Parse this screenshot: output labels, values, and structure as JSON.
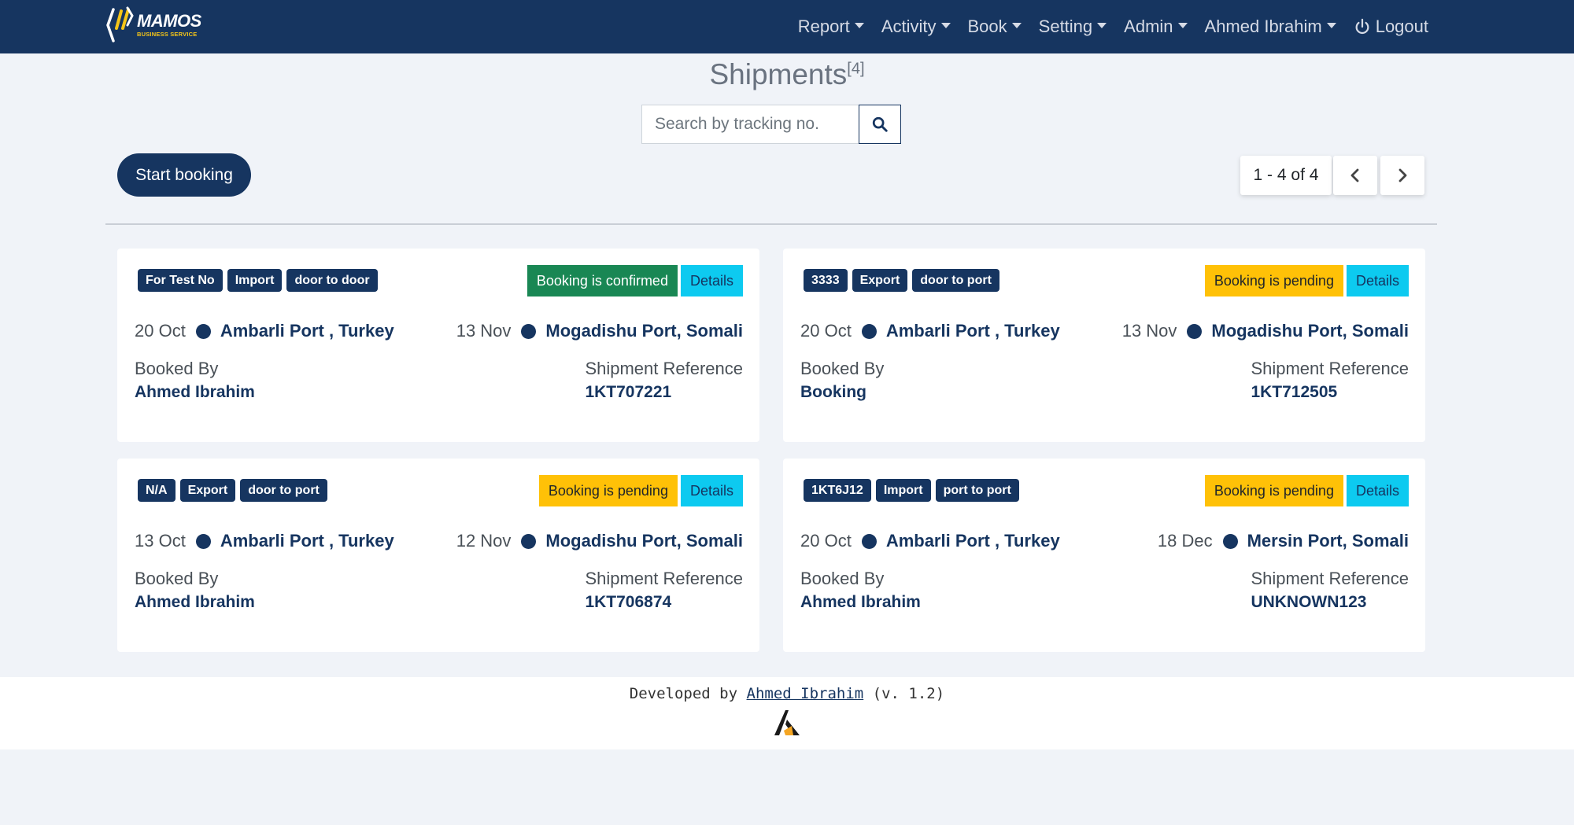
{
  "brand": {
    "name": "MAMOS",
    "tagline": "BUSINESS SERVICE",
    "colors": {
      "primary": "#163560",
      "accent": "#f5c518",
      "success": "#198754",
      "warning": "#ffc107",
      "info": "#0dcaf0"
    }
  },
  "nav": {
    "items": [
      {
        "label": "Report"
      },
      {
        "label": "Activity"
      },
      {
        "label": "Book"
      },
      {
        "label": "Setting"
      },
      {
        "label": "Admin"
      },
      {
        "label": "Ahmed Ibrahim"
      }
    ],
    "logout": "Logout"
  },
  "page": {
    "title": "Shipments",
    "count": "[4]"
  },
  "search": {
    "placeholder": "Search by tracking no.",
    "value": ""
  },
  "actions": {
    "start_booking": "Start booking"
  },
  "pagination": {
    "label": "1 - 4 of 4"
  },
  "shipments": [
    {
      "tags": [
        "For Test No",
        "Import",
        "door to door"
      ],
      "status": "Booking is confirmed",
      "status_type": "confirmed",
      "details": "Details",
      "origin_date": "20 Oct",
      "origin": "Ambarli Port , Turkey",
      "dest_date": "13 Nov",
      "destination": "Mogadishu Port, Somali",
      "booked_by_label": "Booked By",
      "booked_by": "Ahmed Ibrahim",
      "ref_label": "Shipment Reference",
      "reference": "1KT707221"
    },
    {
      "tags": [
        "3333",
        "Export",
        "door to port"
      ],
      "status": "Booking is pending",
      "status_type": "pending",
      "details": "Details",
      "origin_date": "20 Oct",
      "origin": "Ambarli Port , Turkey",
      "dest_date": "13 Nov",
      "destination": "Mogadishu Port, Somali",
      "booked_by_label": "Booked By",
      "booked_by": "Booking",
      "ref_label": "Shipment Reference",
      "reference": "1KT712505"
    },
    {
      "tags": [
        "N/A",
        "Export",
        "door to port"
      ],
      "status": "Booking is pending",
      "status_type": "pending",
      "details": "Details",
      "origin_date": "13 Oct",
      "origin": "Ambarli Port , Turkey",
      "dest_date": "12 Nov",
      "destination": "Mogadishu Port, Somali",
      "booked_by_label": "Booked By",
      "booked_by": "Ahmed Ibrahim",
      "ref_label": "Shipment Reference",
      "reference": "1KT706874"
    },
    {
      "tags": [
        "1KT6J12",
        "Import",
        "port to port"
      ],
      "status": "Booking is pending",
      "status_type": "pending",
      "details": "Details",
      "origin_date": "20 Oct",
      "origin": "Ambarli Port , Turkey",
      "dest_date": "18 Dec",
      "destination": "Mersin Port, Somali",
      "booked_by_label": "Booked By",
      "booked_by": "Ahmed Ibrahim",
      "ref_label": "Shipment Reference",
      "reference": "UNKNOWN123"
    }
  ],
  "footer": {
    "prefix": "Developed by ",
    "author": "Ahmed Ibrahim",
    "version": " (v. 1.2)"
  }
}
